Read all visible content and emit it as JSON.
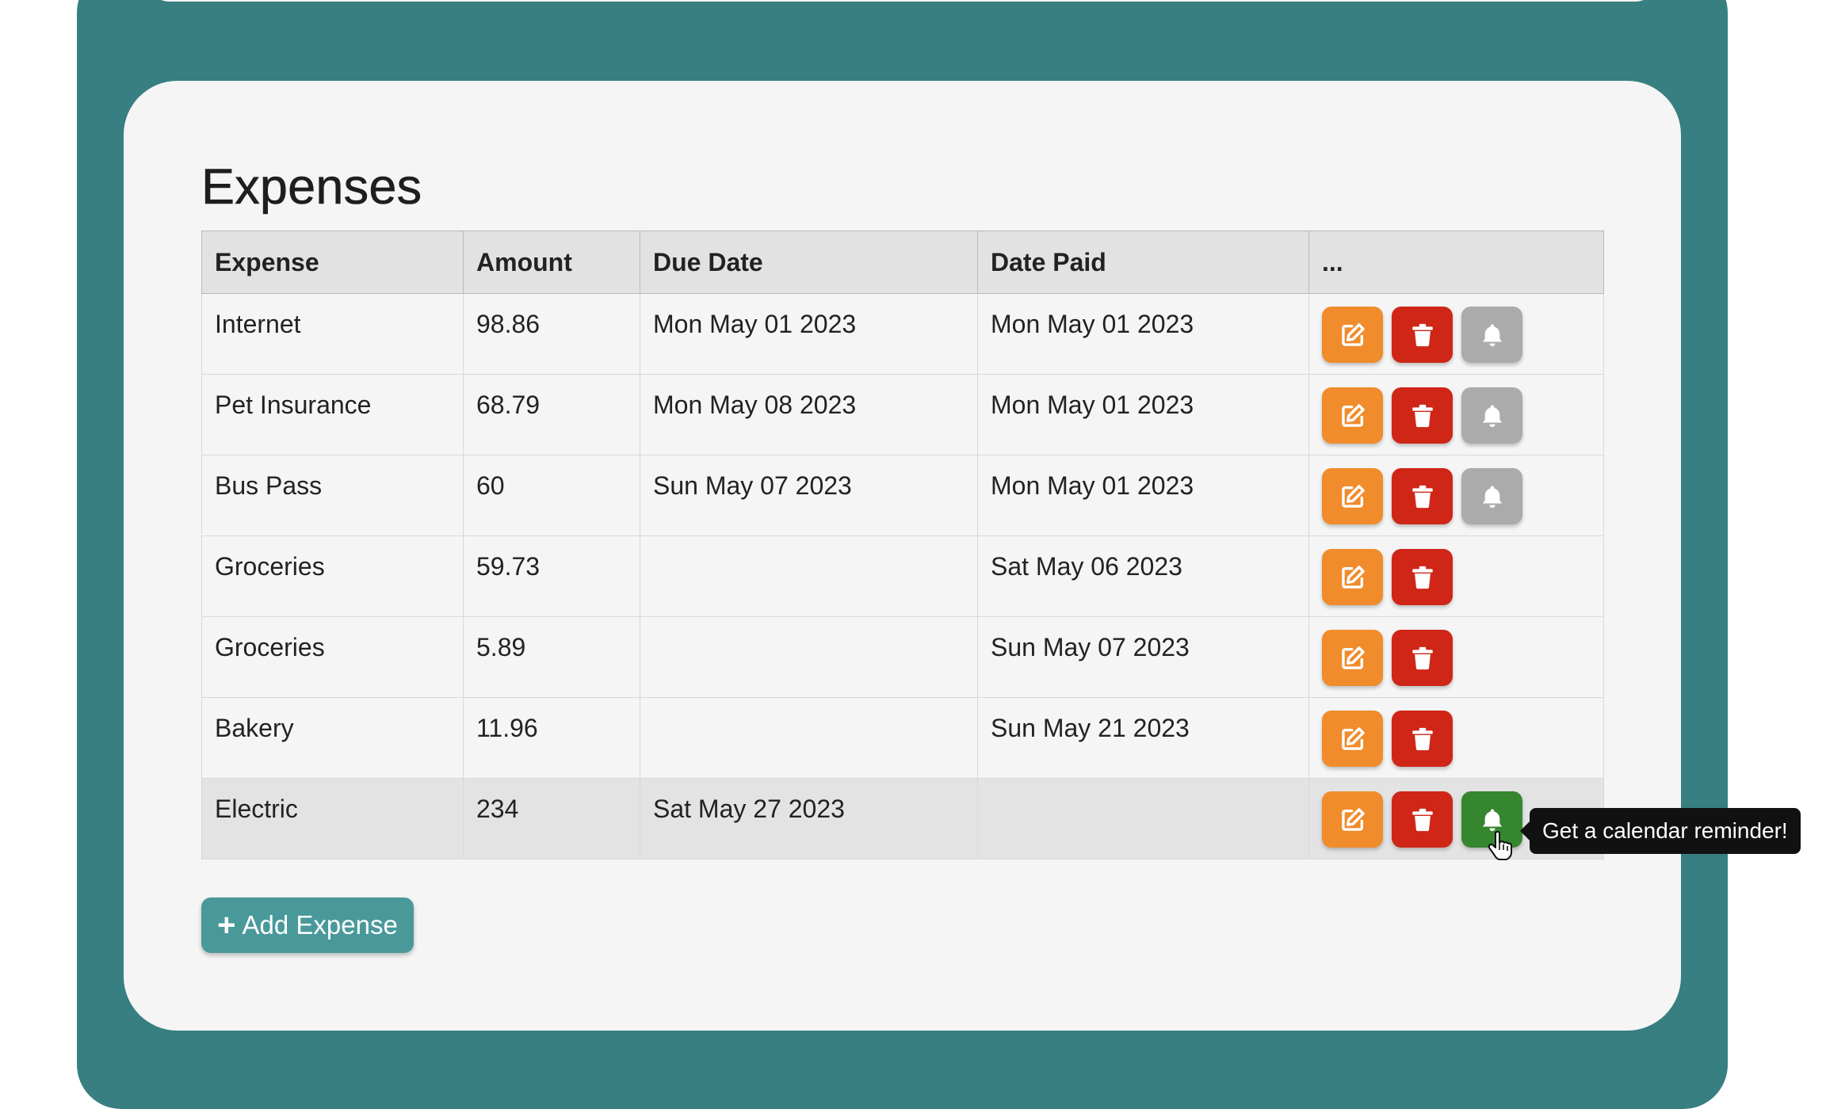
{
  "page": {
    "title": "Expenses"
  },
  "table": {
    "headers": [
      "Expense",
      "Amount",
      "Due Date",
      "Date Paid",
      "..."
    ],
    "rows": [
      {
        "expense": "Internet",
        "amount": "98.86",
        "due_date": "Mon May 01 2023",
        "date_paid": "Mon May 01 2023",
        "has_reminder": true,
        "reminder_active": false
      },
      {
        "expense": "Pet Insurance",
        "amount": "68.79",
        "due_date": "Mon May 08 2023",
        "date_paid": "Mon May 01 2023",
        "has_reminder": true,
        "reminder_active": false
      },
      {
        "expense": "Bus Pass",
        "amount": "60",
        "due_date": "Sun May 07 2023",
        "date_paid": "Mon May 01 2023",
        "has_reminder": true,
        "reminder_active": false
      },
      {
        "expense": "Groceries",
        "amount": "59.73",
        "due_date": "",
        "date_paid": "Sat May 06 2023",
        "has_reminder": false,
        "reminder_active": false
      },
      {
        "expense": "Groceries",
        "amount": "5.89",
        "due_date": "",
        "date_paid": "Sun May 07 2023",
        "has_reminder": false,
        "reminder_active": false
      },
      {
        "expense": "Bakery",
        "amount": "11.96",
        "due_date": "",
        "date_paid": "Sun May 21 2023",
        "has_reminder": false,
        "reminder_active": false
      },
      {
        "expense": "Electric",
        "amount": "234",
        "due_date": "Sat May 27 2023",
        "date_paid": "",
        "has_reminder": true,
        "reminder_active": true
      }
    ]
  },
  "tooltip": {
    "text": "Get a calendar reminder!"
  },
  "add_button": {
    "icon": "+",
    "label": "Add Expense"
  },
  "icons": {
    "edit": "edit-icon",
    "delete": "trash-icon",
    "reminder": "bell-icon"
  },
  "colors": {
    "background": "#377f80",
    "card": "#f5f5f5",
    "edit": "#f08c2b",
    "delete": "#cf2618",
    "reminder_inactive": "#ababab",
    "reminder_active": "#35862e",
    "add_button": "#4a999a"
  }
}
